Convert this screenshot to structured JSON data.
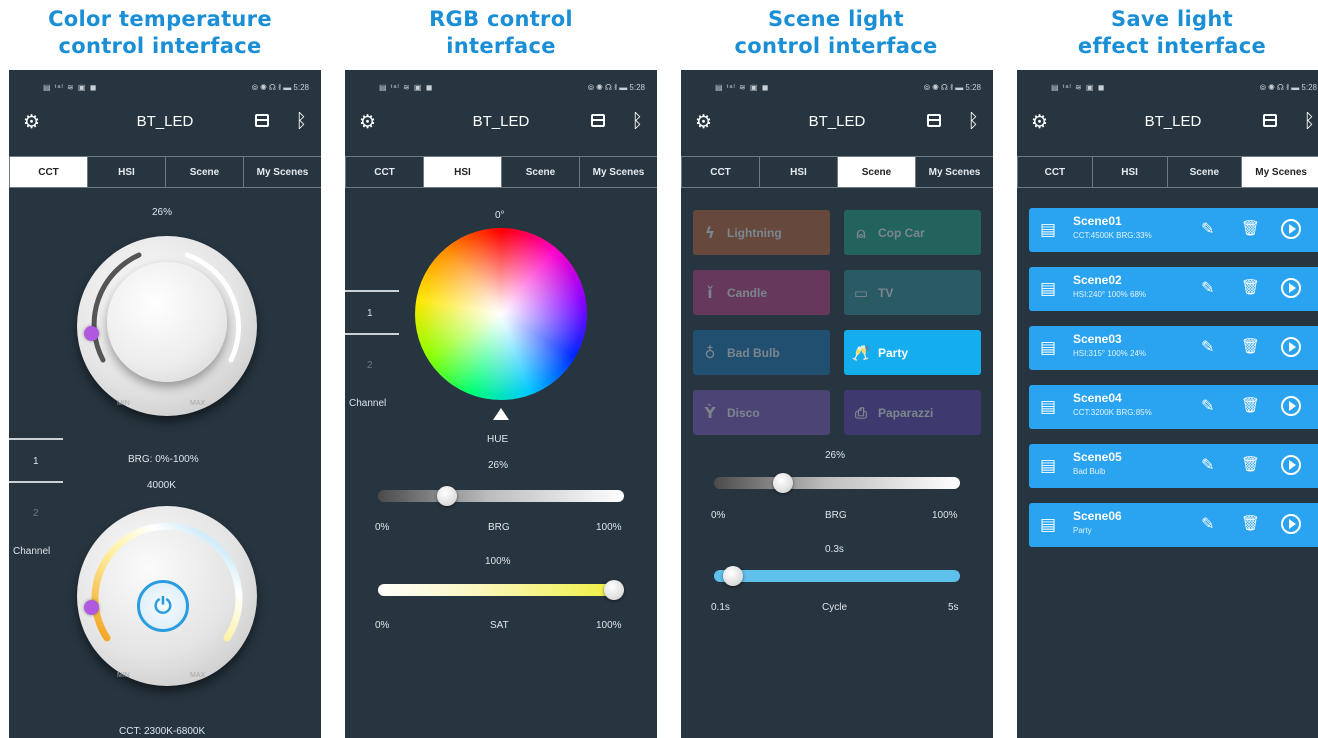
{
  "titles": {
    "p1": [
      "Color temperature",
      "control interface"
    ],
    "p2": [
      "RGB control",
      "interface"
    ],
    "p3": [
      "Scene light",
      "control interface"
    ],
    "p4": [
      "Save light",
      "effect interface"
    ]
  },
  "status": {
    "left": "▤ ᵗᵃˡ ≋ ▣ ◼",
    "right": "⦾ ◉ ☊ ∦ ▬ 5:28"
  },
  "app": {
    "title": "BT_LED",
    "icons": [
      "gear-icon",
      "save-icon",
      "bluetooth-icon"
    ]
  },
  "tabs": [
    "CCT",
    "HSI",
    "Scene",
    "My Scenes"
  ],
  "channel": {
    "label": "Channel",
    "items": [
      "1",
      "2"
    ]
  },
  "cct": {
    "brightness_pct": "26%",
    "min": "MIN",
    "max": "MAX",
    "brg_range": "BRG: 0%-100%",
    "temperature": "4000K",
    "cct_range": "CCT: 2300K-6800K"
  },
  "hsi": {
    "hue_value": "0°",
    "hue_label": "HUE",
    "brg_value": "26%",
    "brg_level": 0.26,
    "brg_min": "0%",
    "brg_label": "BRG",
    "brg_max": "100%",
    "sat_value": "100%",
    "sat_level": 1.0,
    "sat_min": "0%",
    "sat_label": "SAT",
    "sat_max": "100%"
  },
  "scene": {
    "buttons": [
      {
        "label": "Lightning",
        "icon": "lightning-icon",
        "color": "#b5603a",
        "active": false
      },
      {
        "label": "Cop Car",
        "icon": "siren-icon",
        "color": "#1f9b82",
        "active": false
      },
      {
        "label": "Candle",
        "icon": "candle-icon",
        "color": "#b43c7c",
        "active": false
      },
      {
        "label": "TV",
        "icon": "tv-icon",
        "color": "#2f8a93",
        "active": false
      },
      {
        "label": "Bad Bulb",
        "icon": "bulb-icon",
        "color": "#1b6fa8",
        "active": false
      },
      {
        "label": "Party",
        "icon": "party-icon",
        "color": "#14aeef",
        "active": true
      },
      {
        "label": "Disco",
        "icon": "cocktail-icon",
        "color": "#7d57b8",
        "active": false
      },
      {
        "label": "Paparazzi",
        "icon": "camera-icon",
        "color": "#5a3fa6",
        "active": false
      }
    ],
    "brg_value": "26%",
    "brg_level": 0.26,
    "brg_min": "0%",
    "brg_label": "BRG",
    "brg_max": "100%",
    "cycle_value": "0.3s",
    "cycle_level": 0.04,
    "cycle_min": "0.1s",
    "cycle_label": "Cycle",
    "cycle_max": "5s"
  },
  "saved": [
    {
      "name": "Scene01",
      "detail": "CCT:4500K BRG:33%"
    },
    {
      "name": "Scene02",
      "detail": "HSI:240°  100% 68%"
    },
    {
      "name": "Scene03",
      "detail": "HSI:315°  100% 24%"
    },
    {
      "name": "Scene04",
      "detail": "CCT:3200K BRG:85%"
    },
    {
      "name": "Scene05",
      "detail": "Bad Bulb"
    },
    {
      "name": "Scene06",
      "detail": "Party"
    }
  ],
  "colors": {
    "accent": "#1a8fd6",
    "panel": "#273540",
    "row": "#2aa3f0"
  }
}
